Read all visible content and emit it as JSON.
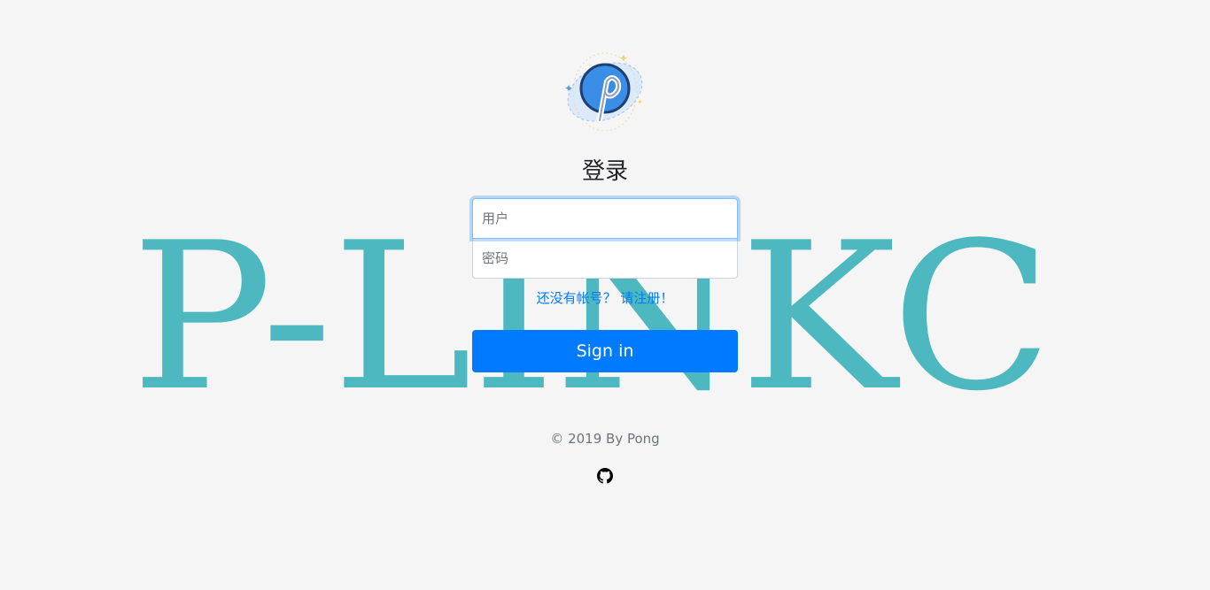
{
  "background_watermark": {
    "text": "P-LINKC",
    "color": "#4eb8c0"
  },
  "logo": {
    "icon": "pinterest-p-logo",
    "colors": {
      "primary": "#3a8ee6",
      "outline": "#1d3f72",
      "orbit": "#dbe9fb"
    }
  },
  "login": {
    "title": "登录",
    "username_placeholder": "用户",
    "password_placeholder": "密码",
    "register_link": "还没有帐号？ 请注册！",
    "signin_label": "Sign in"
  },
  "footer": {
    "copyright": "© 2019 By Pong",
    "github_icon": "github-icon"
  },
  "colors": {
    "background": "#f5f5f5",
    "accent": "#007bff",
    "muted": "#6c757d"
  }
}
